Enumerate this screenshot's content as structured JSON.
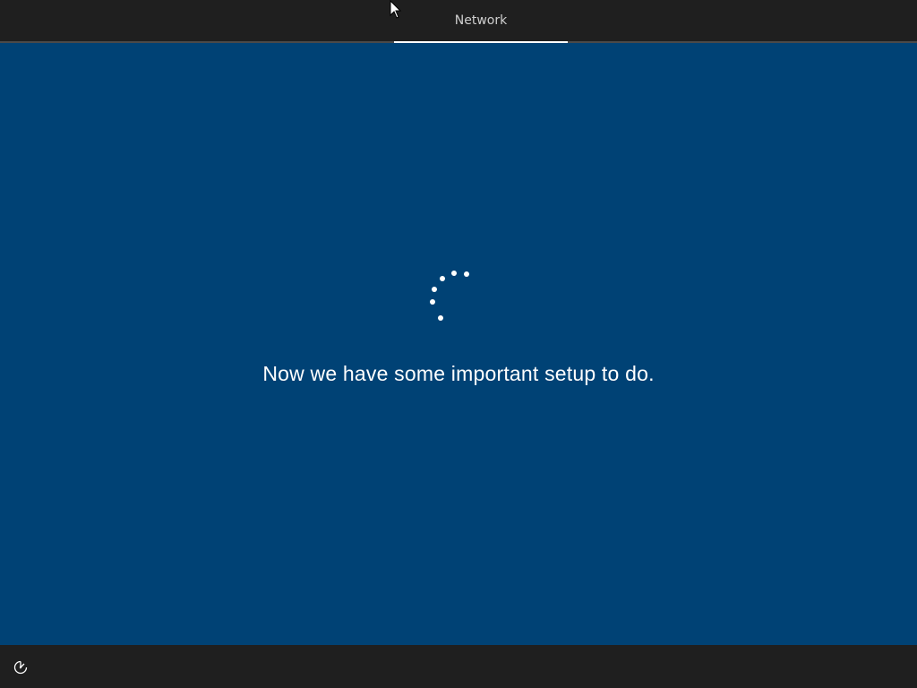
{
  "header": {
    "tabs": [
      {
        "label": "Network",
        "active": true
      }
    ]
  },
  "main": {
    "spinner_icon": "loading-dots",
    "message": "Now we have some important setup to do."
  },
  "footer": {
    "ease_of_access_icon": "ease-of-access-icon"
  },
  "colors": {
    "background": "#004275",
    "bars": "#1f1f1f",
    "text": "#ffffff",
    "tab_text": "#cfcfcf"
  }
}
